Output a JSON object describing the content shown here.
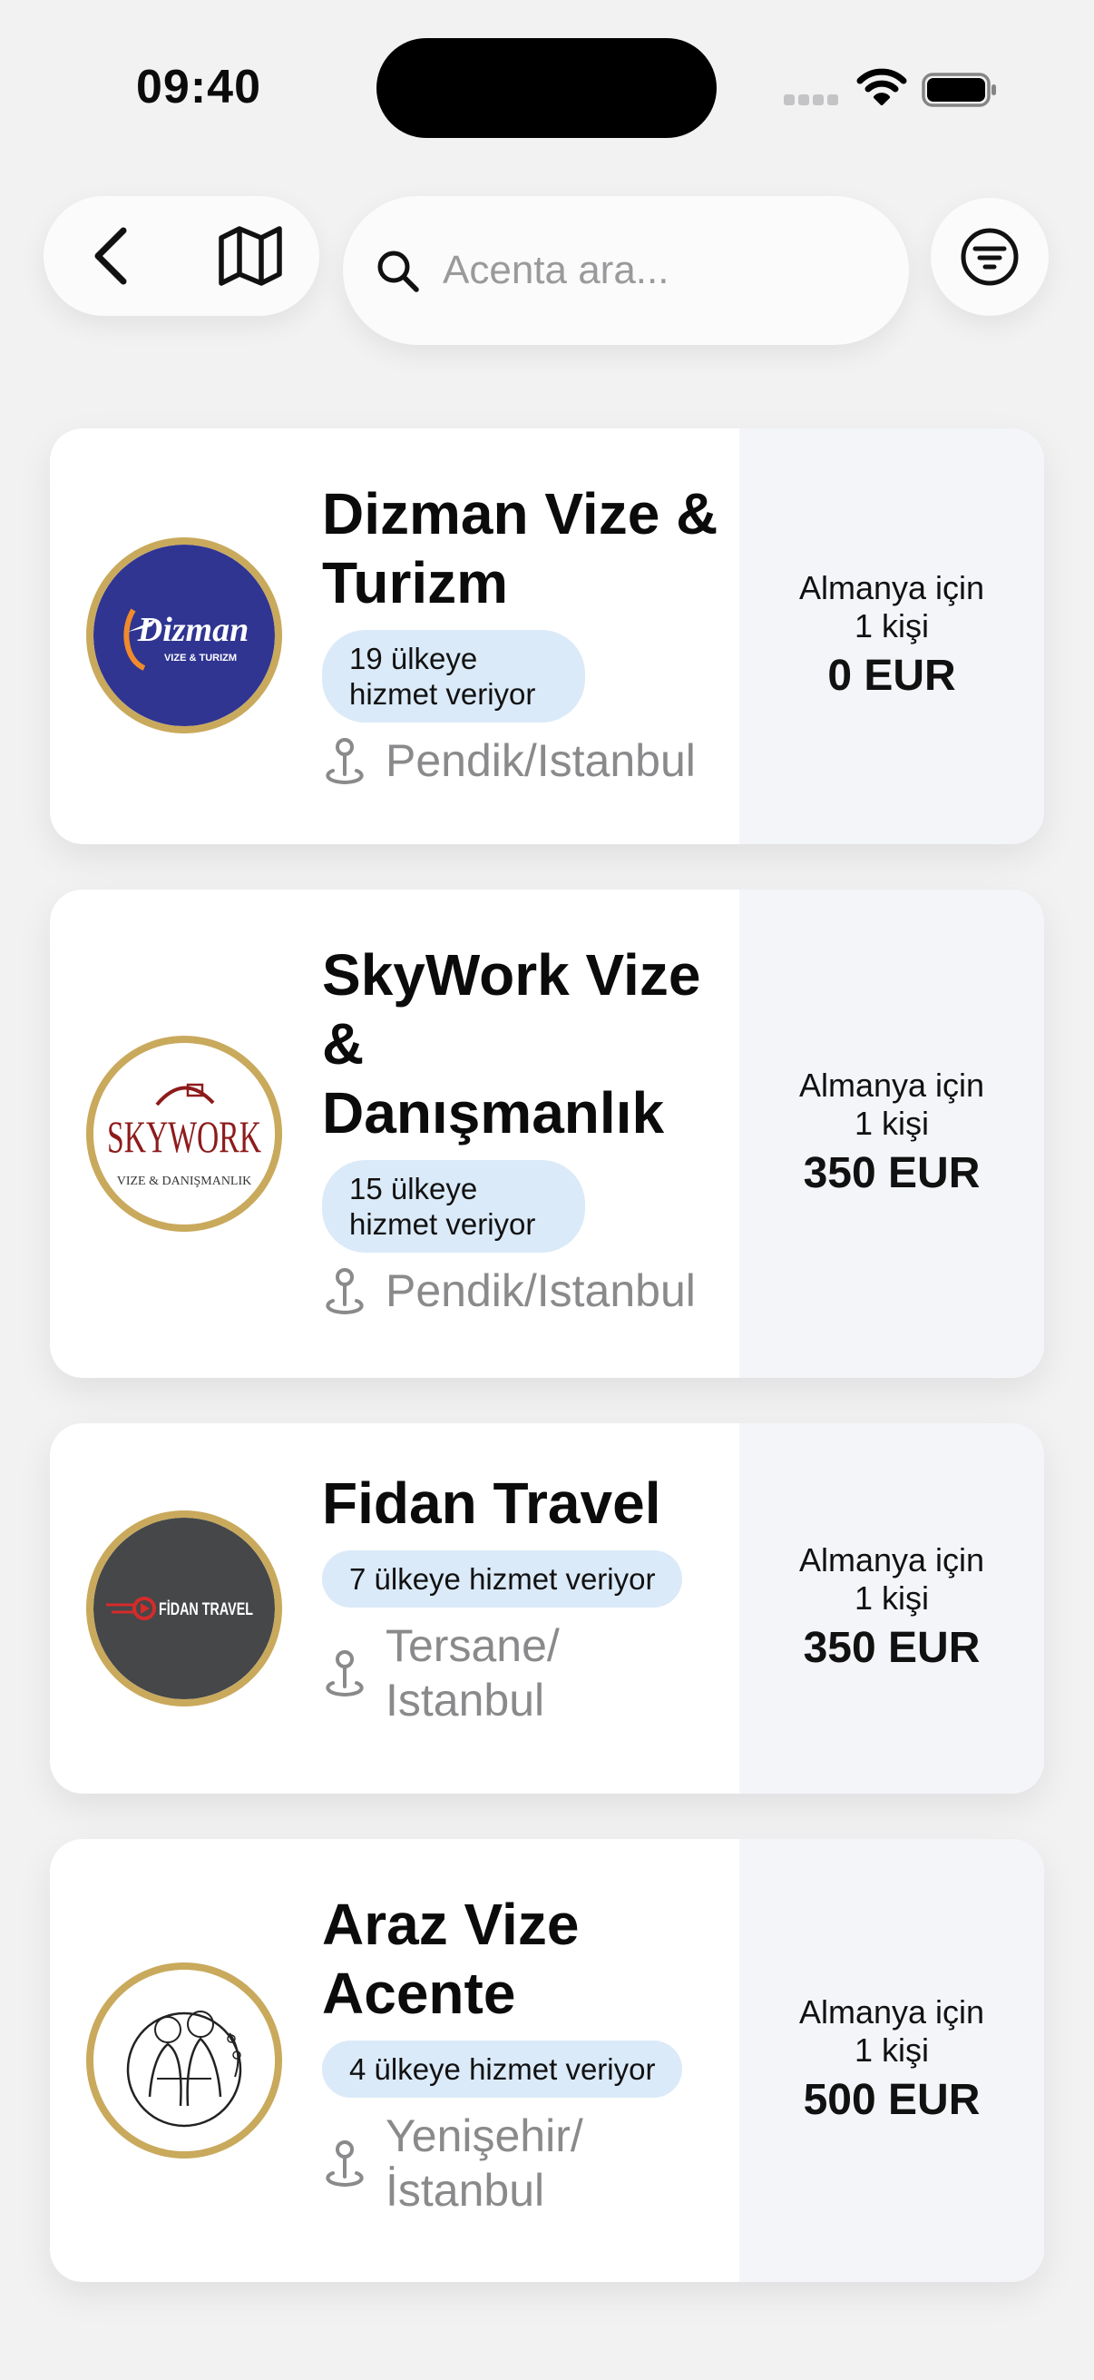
{
  "status_bar": {
    "time": "09:40"
  },
  "search": {
    "placeholder": "Acenta ara..."
  },
  "icons": {
    "back": "chevron-left-icon",
    "map": "map-icon",
    "search": "search-icon",
    "filter": "filter-icon",
    "pin": "map-pin-icon"
  },
  "colors": {
    "badge_bg": "#dbeaf8",
    "logo_ring": "#c9a95c",
    "price_panel": "#f4f5f8",
    "muted_text": "#8a8a8c"
  },
  "agencies": [
    {
      "name": "Dizman Vize & Turizm",
      "logo_text": "Dizman",
      "logo_subtext": "VIZE & TURIZM",
      "badge": "19 ülkeye hizmet veriyor",
      "location": "Pendik/Istanbul",
      "price_caption": "Almanya için 1 kişi",
      "price": "0 EUR"
    },
    {
      "name": "SkyWork Vize & Danışmanlık",
      "logo_text": "SKYWORK",
      "logo_subtext": "VIZE & DANIŞMANLIK",
      "badge": "15 ülkeye hizmet veriyor",
      "location": "Pendik/Istanbul",
      "price_caption": "Almanya için 1 kişi",
      "price": "350 EUR"
    },
    {
      "name": "Fidan Travel",
      "logo_text": "FİDAN TRAVEL",
      "badge": "7 ülkeye hizmet veriyor",
      "location": "Tersane/ Istanbul",
      "price_caption": "Almanya için 1 kişi",
      "price": "350 EUR"
    },
    {
      "name": "Araz Vize Acente",
      "badge": "4 ülkeye hizmet veriyor",
      "location": "Yenişehir/ İstanbul",
      "price_caption": "Almanya için 1 kişi",
      "price": "500 EUR"
    }
  ]
}
